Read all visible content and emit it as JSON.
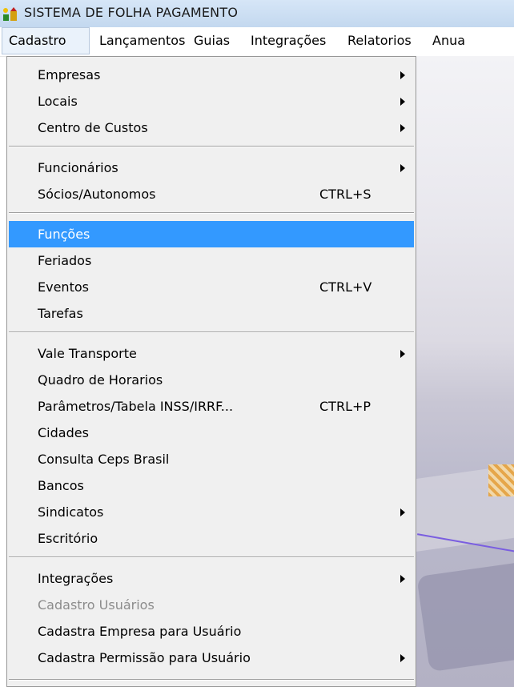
{
  "window": {
    "title": "SISTEMA DE FOLHA PAGAMENTO"
  },
  "menubar": [
    "Cadastro",
    "Lançamentos",
    "Guias",
    "Integrações",
    "Relatorios",
    "Anua"
  ],
  "cadastro_menu": {
    "items": [
      {
        "label": "Empresas",
        "submenu": true
      },
      {
        "label": "Locais",
        "submenu": true
      },
      {
        "label": "Centro de Custos",
        "submenu": true
      },
      {
        "label": "Funcionários",
        "submenu": true
      },
      {
        "label": "Sócios/Autonomos",
        "shortcut": "CTRL+S"
      },
      {
        "label": "Funções",
        "highlighted": true
      },
      {
        "label": "Feriados"
      },
      {
        "label": "Eventos",
        "shortcut": "CTRL+V"
      },
      {
        "label": "Tarefas"
      },
      {
        "label": "Vale Transporte",
        "submenu": true
      },
      {
        "label": "Quadro de Horarios"
      },
      {
        "label": "Parâmetros/Tabela INSS/IRRF...",
        "shortcut": "CTRL+P"
      },
      {
        "label": "Cidades"
      },
      {
        "label": "Consulta Ceps Brasil"
      },
      {
        "label": "Bancos"
      },
      {
        "label": "Sindicatos",
        "submenu": true
      },
      {
        "label": "Escritório"
      },
      {
        "label": "Integrações",
        "submenu": true
      },
      {
        "label": "Cadastro Usuários",
        "disabled": true
      },
      {
        "label": "Cadastra Empresa para Usuário"
      },
      {
        "label": "Cadastra Permissão para Usuário",
        "submenu": true
      }
    ]
  },
  "colors": {
    "highlight": "#3399ff",
    "menu_bg": "#f0f0f0",
    "disabled_text": "#8c8c8c"
  }
}
